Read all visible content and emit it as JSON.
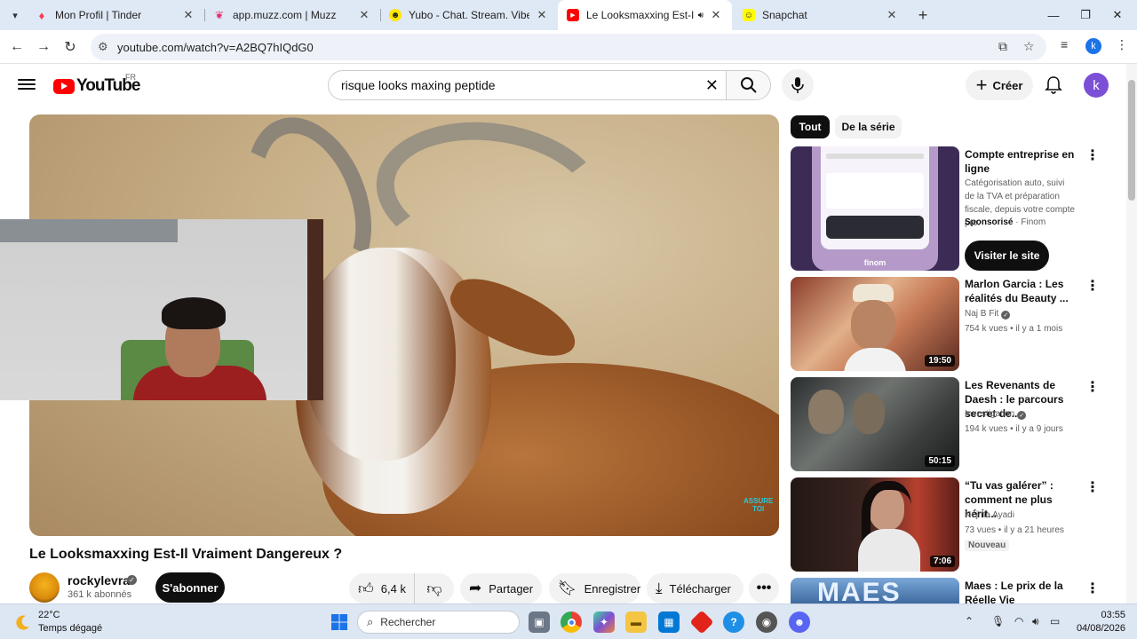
{
  "browser": {
    "tabs": [
      {
        "label": "Mon Profil | Tinder",
        "icon": "tinder-flame-icon"
      },
      {
        "label": "app.muzz.com | Muzz",
        "icon": "muzz-butterfly-icon"
      },
      {
        "label": "Yubo - Chat. Stream. Vibe.",
        "icon": "yubo-icon"
      },
      {
        "label": "Le Looksmaxxing Est-Il Vrai",
        "icon": "youtube-icon",
        "active": true
      },
      {
        "label": "Snapchat",
        "icon": "snapchat-ghost-icon"
      }
    ],
    "url": "youtube.com/watch?v=A2BQ7hIQdG0",
    "profile_initial": "k"
  },
  "youtube": {
    "logo_text": "YouTube",
    "region": "FR",
    "search_query": "risque looks maxing peptide",
    "create_label": "Créer",
    "avatar_initial": "k"
  },
  "video": {
    "watermark": "ASSURE\nTOI",
    "title": "Le Looksmaxxing Est-Il Vraiment Dangereux ?",
    "channel": "rockylevrai",
    "subscribers": "361 k abonnés",
    "subscribe_label": "S'abonner",
    "likes": "6,4 k",
    "share_label": "Partager",
    "save_label": "Enregistrer",
    "download_label": "Télécharger"
  },
  "chips": [
    "Tout",
    "De la série"
  ],
  "ad": {
    "title": "Compte entreprise en ligne",
    "description": "Catégorisation auto, suivi de la TVA et préparation fiscale, depuis votre compte pro.",
    "sponsored": "Sponsorisé",
    "advertiser": "Finom",
    "cta": "Visiter le site",
    "thumb_brand": "finom"
  },
  "recommendations": [
    {
      "title": "Marlon Garcia : Les réalités du Beauty ...",
      "channel": "Naj B Fit",
      "verified": true,
      "meta": "754 k vues • il y a 1 mois",
      "duration": "19:50"
    },
    {
      "title": "Les Revenants de Daesh : le parcours secret de...",
      "channel": "Investigation",
      "verified": true,
      "meta": "194 k vues • il y a 9 jours",
      "duration": "50:15"
    },
    {
      "title": "“Tu vas galérer” : comment ne plus hérit...",
      "channel": "Nejma Ayadi",
      "verified": false,
      "meta": "73 vues • il y a 21 heures",
      "duration": "7:06",
      "badge": "Nouveau"
    },
    {
      "title": "Maes : Le prix de la Réelle Vie",
      "thumb_text": "MAES"
    }
  ],
  "taskbar": {
    "temperature": "22°C",
    "weather": "Temps dégagé",
    "search_placeholder": "Rechercher",
    "time": "03:55",
    "date": "04/08/2026"
  },
  "colors": {
    "yt_red": "#ff0000",
    "accent_blue": "#1a73e8"
  }
}
